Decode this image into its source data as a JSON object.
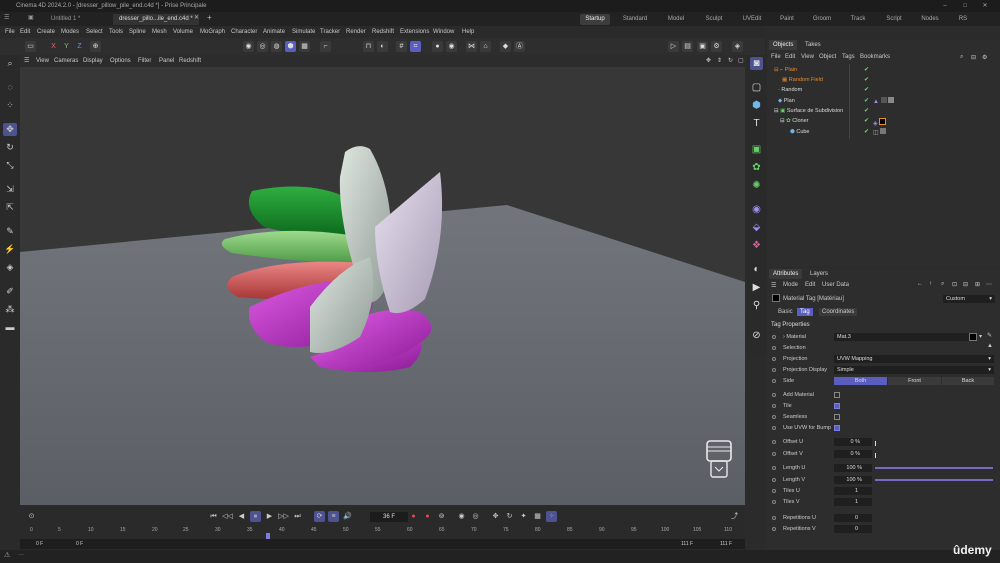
{
  "window": {
    "title": "Cinema 4D 2024.2.0 - [dresser_pillow_pile_end.c4d *] - Prise Principale"
  },
  "doc_tabs": [
    "Untitled 1 *",
    "dresser_pillo...ile_end.c4d *"
  ],
  "layouts": [
    "Startup",
    "Standard",
    "Model",
    "Sculpt",
    "UVEdit",
    "Paint",
    "Groom",
    "Track",
    "Script",
    "Nodes",
    "RS"
  ],
  "menu": [
    "File",
    "Edit",
    "Create",
    "Modes",
    "Select",
    "Tools",
    "Spline",
    "Mesh",
    "Volume",
    "MoGraph",
    "Character",
    "Animate",
    "Simulate",
    "Tracker",
    "Render",
    "Redshift",
    "Extensions",
    "Window",
    "Help"
  ],
  "axis_toolbar": {
    "x": "X",
    "y": "Y",
    "z": "Z"
  },
  "viewport_menu": [
    "View",
    "Cameras",
    "Display",
    "Options",
    "Filter",
    "Panel",
    "Redshift"
  ],
  "timeline": {
    "current_frame": "36 F",
    "ticks": [
      "0",
      "5",
      "10",
      "15",
      "20",
      "25",
      "30",
      "35",
      "40",
      "45",
      "50",
      "55",
      "60",
      "65",
      "70",
      "75",
      "80",
      "85",
      "90",
      "95",
      "100",
      "105",
      "110"
    ],
    "range_start": "0 F",
    "range_start2": "0 F",
    "range_end": "111 F",
    "range_end2": "111 F"
  },
  "objects_panel": {
    "tabs": [
      "Objects",
      "Takes"
    ],
    "menu": [
      "File",
      "Edit",
      "View",
      "Object",
      "Tags",
      "Bookmarks"
    ],
    "rows": [
      {
        "name": "Plain"
      },
      {
        "name": "Random Field"
      },
      {
        "name": "Random"
      },
      {
        "name": "Plan"
      },
      {
        "name": "Surface de Subdivision"
      },
      {
        "name": "Cloner"
      },
      {
        "name": "Cube"
      }
    ]
  },
  "attributes_panel": {
    "tabs": [
      "Attributes",
      "Layers"
    ],
    "menu": [
      "Mode",
      "Edit",
      "User Data"
    ],
    "object_label": "Material Tag [Matériau]",
    "custom_label": "Custom",
    "subtabs": [
      "Basic",
      "Tag",
      "Coordinates"
    ],
    "section_title": "Tag Properties",
    "fields": {
      "material_label": "Material",
      "material_value": "Mat.3",
      "selection_label": "Selection",
      "projection_label": "Projection",
      "projection_value": "UVW Mapping",
      "projection_display_label": "Projection Display",
      "projection_display_value": "Simple",
      "side_label": "Side",
      "side_both": "Both",
      "side_front": "Front",
      "side_back": "Back",
      "add_material_label": "Add Material",
      "tile_label": "Tile",
      "seamless_label": "Seamless",
      "use_uvw_label": "Use UVW for Bump",
      "offset_u_label": "Offset U",
      "offset_u_value": "0 %",
      "offset_v_label": "Offset V",
      "offset_v_value": "0 %",
      "length_u_label": "Length U",
      "length_u_value": "100 %",
      "length_v_label": "Length V",
      "length_v_value": "100 %",
      "tiles_u_label": "Tiles U",
      "tiles_u_value": "1",
      "tiles_v_label": "Tiles V",
      "tiles_v_value": "1",
      "rep_u_label": "Repetitions U",
      "rep_u_value": "0",
      "rep_v_label": "Repetitions V",
      "rep_v_value": "0"
    }
  },
  "watermark": "ûdemy",
  "colors": {
    "accent": "#5a5fbf",
    "viewport_bg": "#373737",
    "floor": "#6a6c74",
    "orange": "#e8892b"
  }
}
